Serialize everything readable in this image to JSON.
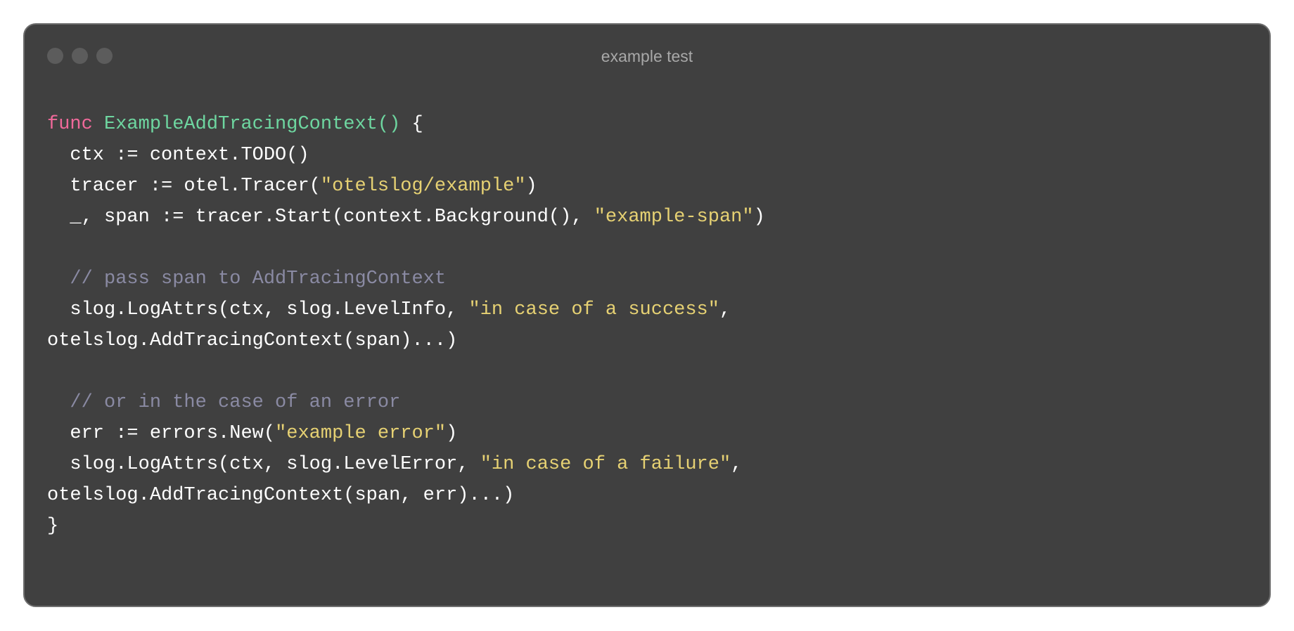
{
  "window": {
    "title": "example test",
    "controls": [
      "close-dot",
      "minimize-dot",
      "maximize-dot"
    ]
  },
  "code": {
    "language": "go",
    "lines": [
      [
        {
          "t": "kw",
          "v": "func "
        },
        {
          "t": "fn",
          "v": "ExampleAddTracingContext() "
        },
        {
          "t": "plain",
          "v": "{"
        }
      ],
      [
        {
          "t": "plain",
          "v": "  ctx := context.TODO()"
        }
      ],
      [
        {
          "t": "plain",
          "v": "  tracer := otel.Tracer("
        },
        {
          "t": "str",
          "v": "\"otelslog/example\""
        },
        {
          "t": "plain",
          "v": ")"
        }
      ],
      [
        {
          "t": "plain",
          "v": "  _, span := tracer.Start(context.Background(), "
        },
        {
          "t": "str",
          "v": "\"example-span\""
        },
        {
          "t": "plain",
          "v": ")"
        }
      ],
      [],
      [
        {
          "t": "com",
          "v": "  // pass span to AddTracingContext"
        }
      ],
      [
        {
          "t": "plain",
          "v": "  slog.LogAttrs(ctx, slog.LevelInfo, "
        },
        {
          "t": "str",
          "v": "\"in case of a success\""
        },
        {
          "t": "plain",
          "v": ","
        }
      ],
      [
        {
          "t": "plain",
          "v": "otelslog.AddTracingContext(span)...)"
        }
      ],
      [],
      [
        {
          "t": "com",
          "v": "  // or in the case of an error"
        }
      ],
      [
        {
          "t": "plain",
          "v": "  err := errors.New("
        },
        {
          "t": "str",
          "v": "\"example error\""
        },
        {
          "t": "plain",
          "v": ")"
        }
      ],
      [
        {
          "t": "plain",
          "v": "  slog.LogAttrs(ctx, slog.LevelError, "
        },
        {
          "t": "str",
          "v": "\"in case of a failure\""
        },
        {
          "t": "plain",
          "v": ","
        }
      ],
      [
        {
          "t": "plain",
          "v": "otelslog.AddTracingContext(span, err)...)"
        }
      ],
      [
        {
          "t": "plain",
          "v": "}"
        }
      ]
    ]
  },
  "colors": {
    "background": "#404040",
    "keyword": "#f0699a",
    "function": "#6ed6a0",
    "string": "#e6d173",
    "comment": "#8a8aa3",
    "text": "#ffffff"
  }
}
